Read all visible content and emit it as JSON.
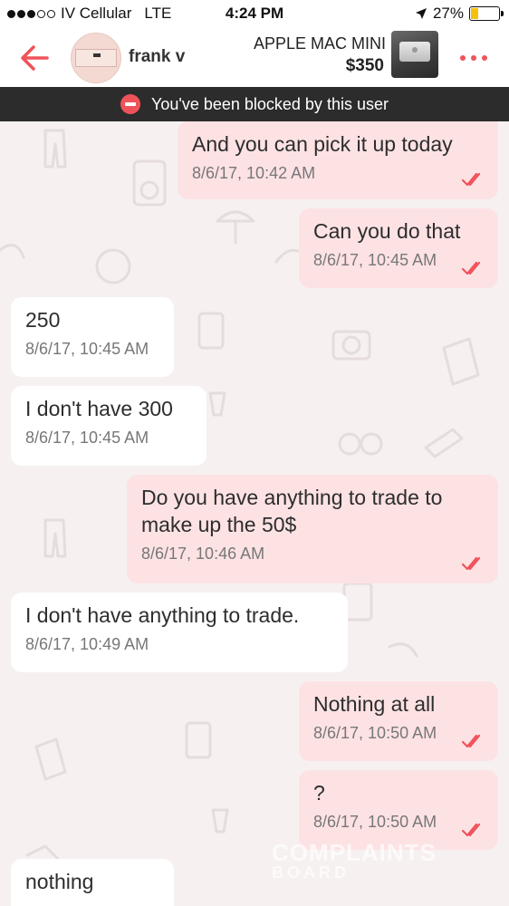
{
  "status_bar": {
    "carrier": "IV Cellular",
    "network": "LTE",
    "time": "4:24 PM",
    "battery": "27%",
    "battery_level": 0.27,
    "signal_bars_filled": 3,
    "signal_bars_total": 5
  },
  "header": {
    "username": "frank v",
    "listing_title": "APPLE MAC MINI",
    "listing_price": "$350",
    "accent_color": "#f0525a"
  },
  "banner": {
    "text": "You've been blocked by this user"
  },
  "messages": [
    {
      "direction": "out",
      "text": "And you can pick it up today",
      "time": "8/6/17, 10:42 AM",
      "read": true
    },
    {
      "direction": "out",
      "text": "Can you do that",
      "time": "8/6/17, 10:45 AM",
      "read": true
    },
    {
      "direction": "in",
      "text": "250",
      "time": "8/6/17, 10:45 AM"
    },
    {
      "direction": "in",
      "text": "I don't have 300",
      "time": "8/6/17, 10:45 AM"
    },
    {
      "direction": "out",
      "text": "Do you have anything to trade to make up the 50$",
      "time": "8/6/17, 10:46 AM",
      "read": true
    },
    {
      "direction": "in",
      "text": "I don't have anything to trade.",
      "time": "8/6/17, 10:49 AM"
    },
    {
      "direction": "out",
      "text": "Nothing at all",
      "time": "8/6/17, 10:50 AM",
      "read": true
    },
    {
      "direction": "out",
      "text": "?",
      "time": "8/6/17, 10:50 AM",
      "read": true
    },
    {
      "direction": "in",
      "text": "nothing",
      "time": ""
    }
  ],
  "watermark": {
    "line1": "COMPLAINTS",
    "line2": "BOARD"
  },
  "colors": {
    "outgoing_bubble": "#fde2e4",
    "incoming_bubble": "#ffffff",
    "background": "#f6f0f1",
    "banner": "#2c2c2c",
    "read_check": "#f0525a"
  }
}
